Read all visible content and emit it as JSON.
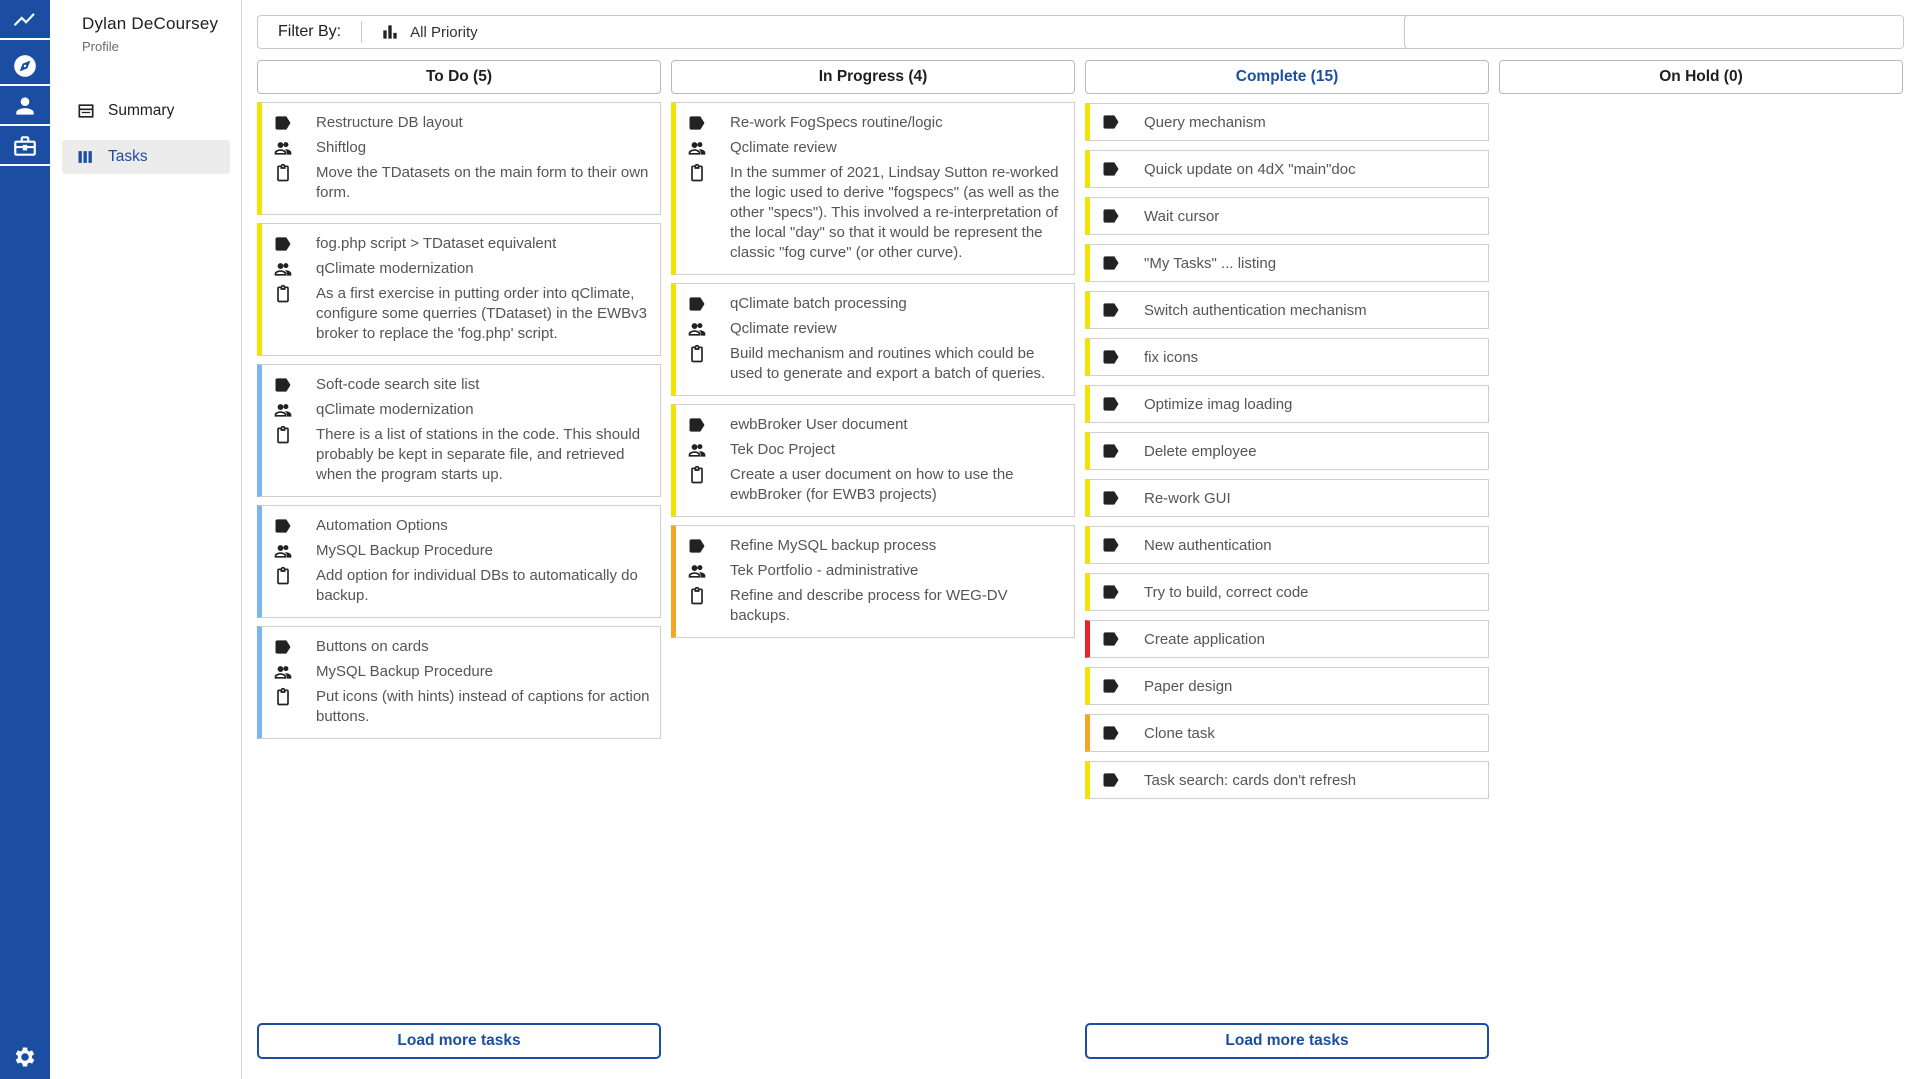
{
  "rail": {
    "icons": [
      "activity-icon",
      "compass-icon",
      "person-icon",
      "briefcase-icon",
      "gear-icon"
    ]
  },
  "sidebar": {
    "user_name": "Dylan DeCoursey",
    "profile_label": "Profile",
    "items": [
      {
        "label": "Summary",
        "icon": "summary-icon"
      },
      {
        "label": "Tasks",
        "icon": "columns-icon"
      }
    ]
  },
  "filter": {
    "label": "Filter By:",
    "priority": "All Priority"
  },
  "search": {
    "placeholder": ""
  },
  "colors": {
    "yellow": "#f2e400",
    "blue": "#7ab6ea",
    "orange": "#f5a623",
    "red": "#e8232d",
    "accent": "#1b4ea3"
  },
  "columns": [
    {
      "title": "To Do (5)",
      "cards": [
        {
          "name": "Restructure DB layout",
          "project": "Shiftlog",
          "desc": "Move the TDatasets on the main form to their own form.",
          "color": "yellow"
        },
        {
          "name": "fog.php script > TDataset equivalent",
          "project": "qClimate modernization",
          "desc": "As a first exercise in putting order into qClimate, configure some querries (TDataset) in the EWBv3 broker to replace the 'fog.php' script.",
          "color": "yellow"
        },
        {
          "name": "Soft-code search site list",
          "project": "qClimate modernization",
          "desc": "There is a list of stations in the code. This should probably be kept in separate file, and retrieved when the program starts up.",
          "color": "blue"
        },
        {
          "name": "Automation Options",
          "project": "MySQL Backup Procedure",
          "desc": "Add option for individual DBs to automatically do backup.",
          "color": "blue"
        },
        {
          "name": "Buttons on cards",
          "project": "MySQL Backup Procedure",
          "desc": "Put icons (with hints) instead of captions for action buttons.",
          "color": "blue"
        }
      ]
    },
    {
      "title": "In Progress (4)",
      "cards": [
        {
          "name": "Re-work FogSpecs routine/logic",
          "project": "Qclimate review",
          "desc": "In the summer of 2021, Lindsay Sutton re-worked the logic used to derive \"fogspecs\" (as well as the other \"specs\"). This involved a re-interpretation of the local \"day\" so that it would be represent the classic \"fog curve\" (or other curve).",
          "color": "yellow"
        },
        {
          "name": "qClimate batch processing",
          "project": "Qclimate review",
          "desc": "Build mechanism and routines which could be used to generate and export a batch of queries.",
          "color": "yellow"
        },
        {
          "name": "ewbBroker User document",
          "project": "Tek Doc Project",
          "desc": "Create a user document on how to use the ewbBroker (for EWB3 projects)",
          "color": "yellow"
        },
        {
          "name": "Refine MySQL backup process",
          "project": "Tek Portfolio - administrative",
          "desc": "Refine and describe process for WEG-DV backups.",
          "color": "orange"
        }
      ]
    },
    {
      "title": "Complete (15)",
      "items": [
        {
          "name": "Query mechanism",
          "color": "yellow"
        },
        {
          "name": "Quick update on 4dX \"main\"doc",
          "color": "yellow"
        },
        {
          "name": "Wait cursor",
          "color": "yellow"
        },
        {
          "name": "\"My Tasks\" ... listing",
          "color": "yellow"
        },
        {
          "name": "Switch authentication mechanism",
          "color": "yellow"
        },
        {
          "name": "fix icons",
          "color": "yellow"
        },
        {
          "name": "Optimize imag loading",
          "color": "yellow"
        },
        {
          "name": "Delete employee",
          "color": "yellow"
        },
        {
          "name": "Re-work GUI",
          "color": "yellow"
        },
        {
          "name": "New authentication",
          "color": "yellow"
        },
        {
          "name": "Try to build, correct code",
          "color": "yellow"
        },
        {
          "name": "Create application",
          "color": "red"
        },
        {
          "name": "Paper design",
          "color": "yellow"
        },
        {
          "name": "Clone task",
          "color": "orange"
        },
        {
          "name": "Task search: cards don't refresh",
          "color": "yellow"
        }
      ]
    },
    {
      "title": "On Hold (0)",
      "cards": []
    }
  ],
  "load_more_label": "Load more tasks"
}
